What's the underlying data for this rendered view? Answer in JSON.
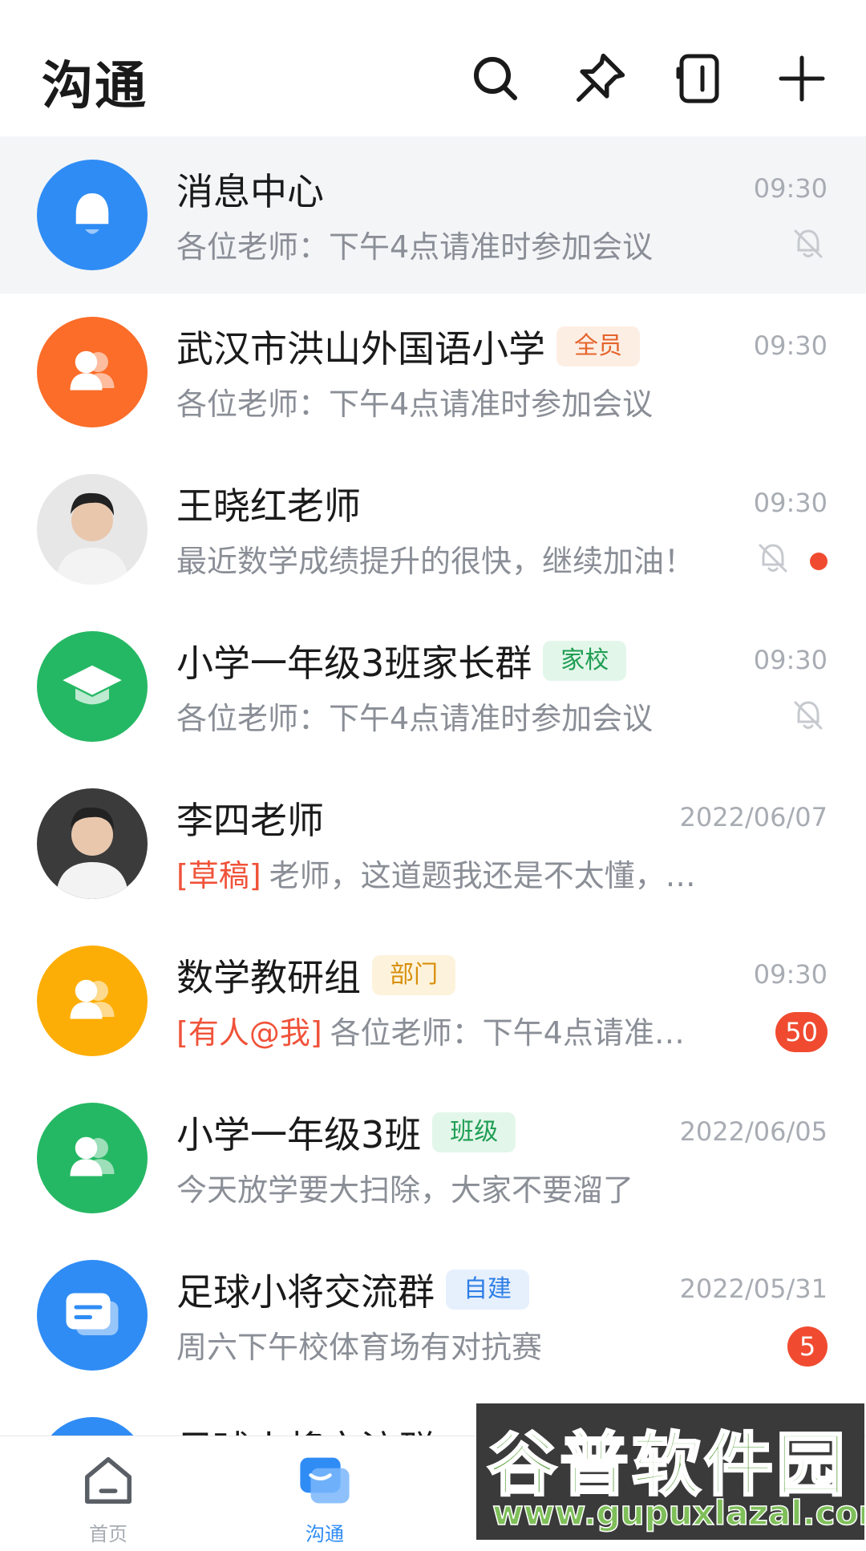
{
  "header": {
    "title": "沟通"
  },
  "conversations": [
    {
      "name": "消息中心",
      "tag": "",
      "time": "09:30",
      "prefix": "",
      "preview": "各位老师：下午4点请准时参加会议",
      "muted": true,
      "unread_dot": false,
      "badge": "",
      "avatar": "bell-icon",
      "color": "#2f8cf5"
    },
    {
      "name": "武汉市洪山外国语小学",
      "tag": "全员",
      "time": "09:30",
      "prefix": "",
      "preview": "各位老师：下午4点请准时参加会议",
      "muted": false,
      "unread_dot": false,
      "badge": "",
      "avatar": "group-icon",
      "color": "#fb6d29"
    },
    {
      "name": "王晓红老师",
      "tag": "",
      "time": "09:30",
      "prefix": "",
      "preview": "最近数学成绩提升的很快，继续加油！",
      "muted": true,
      "unread_dot": true,
      "badge": "",
      "avatar": "user-photo",
      "color": "#e7e7e7"
    },
    {
      "name": "小学一年级3班家长群",
      "tag": "家校",
      "time": "09:30",
      "prefix": "",
      "preview": "各位老师：下午4点请准时参加会议",
      "muted": true,
      "unread_dot": false,
      "badge": "",
      "avatar": "graduation-cap-icon",
      "color": "#25b864"
    },
    {
      "name": "李四老师",
      "tag": "",
      "time": "2022/06/07",
      "prefix": "[草稿]",
      "preview": "老师，这道题我还是不太懂，能麻烦…",
      "muted": false,
      "unread_dot": false,
      "badge": "",
      "avatar": "user-photo",
      "color": "#3b3b3b"
    },
    {
      "name": "数学教研组",
      "tag": "部门",
      "time": "09:30",
      "prefix": "[有人@我]",
      "preview": "各位老师：下午4点请准…",
      "muted": false,
      "unread_dot": false,
      "badge": "50",
      "avatar": "group-icon",
      "color": "#fdae06"
    },
    {
      "name": "小学一年级3班",
      "tag": "班级",
      "time": "2022/06/05",
      "prefix": "",
      "preview": "今天放学要大扫除，大家不要溜了",
      "muted": false,
      "unread_dot": false,
      "badge": "",
      "avatar": "group-icon",
      "color": "#25b864"
    },
    {
      "name": "足球小将交流群",
      "tag": "自建",
      "time": "2022/05/31",
      "prefix": "",
      "preview": "周六下午校体育场有对抗赛",
      "muted": false,
      "unread_dot": false,
      "badge": "5",
      "avatar": "chat-bubble-icon",
      "color": "#2f8cf5"
    },
    {
      "name": "足球小将交流群",
      "tag": "",
      "time": "",
      "prefix": "",
      "preview": "",
      "muted": false,
      "unread_dot": false,
      "badge": "",
      "avatar": "chat-bubble-icon",
      "color": "#2f8cf5"
    }
  ],
  "tag_colors": {
    "全员": {
      "bg": "#fdeee4",
      "fg": "#e5642b"
    },
    "家校": {
      "bg": "#e3f6ea",
      "fg": "#1e9e53"
    },
    "部门": {
      "bg": "#fdf3dc",
      "fg": "#d88f0b"
    },
    "班级": {
      "bg": "#e3f6ea",
      "fg": "#1e9e53"
    },
    "自建": {
      "bg": "#e6f0fd",
      "fg": "#2f7fe6"
    }
  },
  "tabbar": {
    "tabs": [
      {
        "label": "首页",
        "icon": "home-icon",
        "active": false
      },
      {
        "label": "沟通",
        "icon": "chat-icon",
        "active": true
      }
    ],
    "active_color": "#2f8cf5",
    "inactive_color": "#a8acb3"
  },
  "watermark": {
    "title": "谷普软件园",
    "url": "www.gupuxlazal.com"
  }
}
